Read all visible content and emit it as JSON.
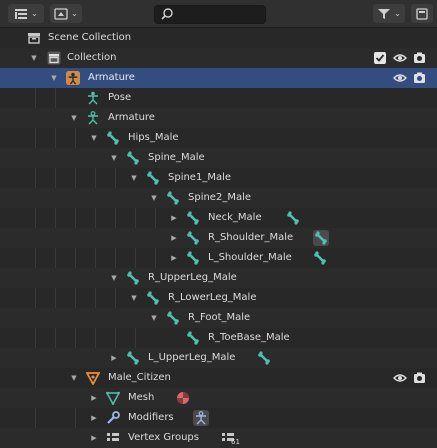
{
  "toolbar": {
    "display_mode_icon": "outliner-display-mode-icon",
    "filter_icon": "funnel-icon",
    "search_placeholder": ""
  },
  "tree": [
    {
      "label": "Scene Collection",
      "icon": "scene-collection-icon"
    },
    {
      "label": "Collection",
      "icon": "collection-icon"
    },
    {
      "label": "Armature",
      "icon": "armature-object-icon"
    },
    {
      "label": "Pose",
      "icon": "pose-icon"
    },
    {
      "label": "Armature",
      "icon": "armature-data-icon"
    },
    {
      "label": "Hips_Male",
      "icon": "bone-icon"
    },
    {
      "label": "Spine_Male",
      "icon": "bone-icon"
    },
    {
      "label": "Spine1_Male",
      "icon": "bone-icon"
    },
    {
      "label": "Spine2_Male",
      "icon": "bone-icon"
    },
    {
      "label": "Neck_Male",
      "icon": "bone-icon"
    },
    {
      "label": "R_Shoulder_Male",
      "icon": "bone-icon"
    },
    {
      "label": "L_Shoulder_Male",
      "icon": "bone-icon"
    },
    {
      "label": "R_UpperLeg_Male",
      "icon": "bone-icon"
    },
    {
      "label": "R_LowerLeg_Male",
      "icon": "bone-icon"
    },
    {
      "label": "R_Foot_Male",
      "icon": "bone-icon"
    },
    {
      "label": "R_ToeBase_Male",
      "icon": "bone-icon"
    },
    {
      "label": "L_UpperLeg_Male",
      "icon": "bone-icon"
    },
    {
      "label": "Male_Citizen",
      "icon": "mesh-object-icon"
    },
    {
      "label": "Mesh",
      "icon": "mesh-data-icon"
    },
    {
      "label": "Modifiers",
      "icon": "wrench-icon"
    },
    {
      "label": "Vertex Groups",
      "icon": "vertex-groups-icon"
    }
  ],
  "badges": {
    "vertex_groups_count": "61"
  },
  "colors": {
    "selected_row": "#334d80",
    "bone": "#4ec2ad",
    "armature": "#e8913a",
    "mesh_object": "#e8913a"
  }
}
